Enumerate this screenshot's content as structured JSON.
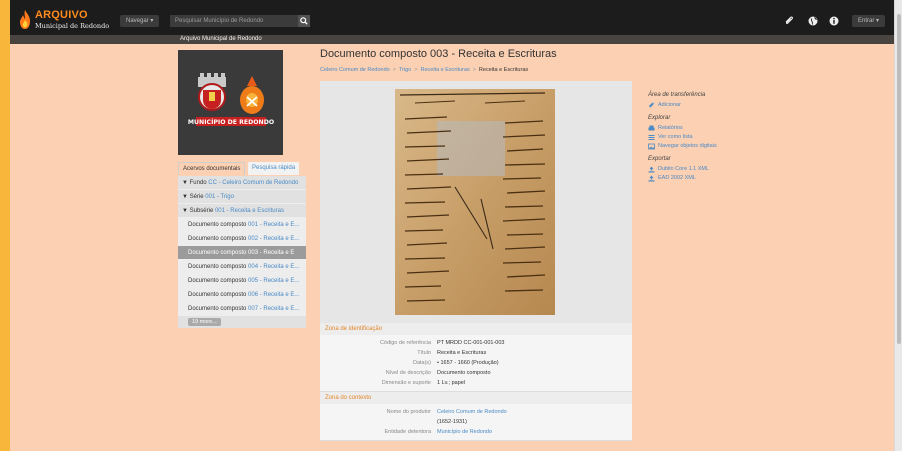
{
  "header": {
    "logo_line1": "ARQUIVO",
    "logo_line2": "Municipal de Redondo",
    "nav_button": "Navegar",
    "search_placeholder": "Pesquisar Município de Redondo",
    "login_button": "Entrar"
  },
  "subheader": {
    "title": "Arquivo Municipal de Redondo"
  },
  "emblem": {
    "banner_text": "MUNICÍPIO DE REDONDO"
  },
  "left_tabs": {
    "active": "Acervos documentais",
    "other": "Pesquisa rápida"
  },
  "tree": {
    "fundo": {
      "prefix": "▼ Fundo ",
      "label": "CC - Celeiro Comum de Redondo"
    },
    "serie": {
      "prefix": "▼ Série ",
      "label": "001 - Trigo"
    },
    "subserie": {
      "prefix": "▼ Subsérie ",
      "label": "001 - Receita e Escrituras"
    },
    "children": [
      {
        "prefix": "Documento composto ",
        "label": "001 - Receita e E..."
      },
      {
        "prefix": "Documento composto ",
        "label": "002 - Receita e E..."
      },
      {
        "prefix": "Documento composto ",
        "label": "003 - Receita e E"
      },
      {
        "prefix": "Documento composto ",
        "label": "004 - Receita e E..."
      },
      {
        "prefix": "Documento composto ",
        "label": "005 - Receita e E..."
      },
      {
        "prefix": "Documento composto ",
        "label": "006 - Receita e E..."
      },
      {
        "prefix": "Documento composto ",
        "label": "007 - Receita e E..."
      }
    ],
    "more": "19 more..."
  },
  "main": {
    "title": "Documento composto 003 - Receita e Escrituras",
    "breadcrumb": [
      "Celeiro Comum de Redondo",
      "Trigo",
      "Receita e Escrituras",
      "Receita e Escrituras"
    ],
    "identification": {
      "heading": "Zona de identificação",
      "fields": [
        {
          "key": "Código de referência",
          "value": "PT MRDD CC-001-001-003"
        },
        {
          "key": "Título",
          "value": "Receita e Escrituras"
        },
        {
          "key": "Data(s)",
          "value": "•  1657 - 1660 (Produção)"
        },
        {
          "key": "Nível de descrição",
          "value": "Documento composto"
        },
        {
          "key": "Dimensão e suporte",
          "value": "1 Lv.; papel"
        }
      ]
    },
    "context": {
      "heading": "Zona do contexto",
      "producer_key": "Nome do produtor",
      "producer_value": "Celeiro Comum de Redondo",
      "producer_dates": "(1652-1931)",
      "entity_key": "Entidade detentora",
      "entity_value": "Município de Redondo"
    }
  },
  "sidebar": {
    "clipboard_heading": "Área de transferência",
    "add": "Adicionar",
    "explore_heading": "Explorar",
    "reports": "Relatórios",
    "list": "Ver como lista",
    "digital": "Navegar objetos digitais",
    "export_heading": "Exportar",
    "dublin": "Dublin Core 1.1 XML",
    "ead": "EAD 2002 XML"
  },
  "colors": {
    "accent": "#4a8ac6",
    "orange": "#e2862c",
    "background": "#fbd0b3",
    "topbar": "#1c1c1c"
  }
}
